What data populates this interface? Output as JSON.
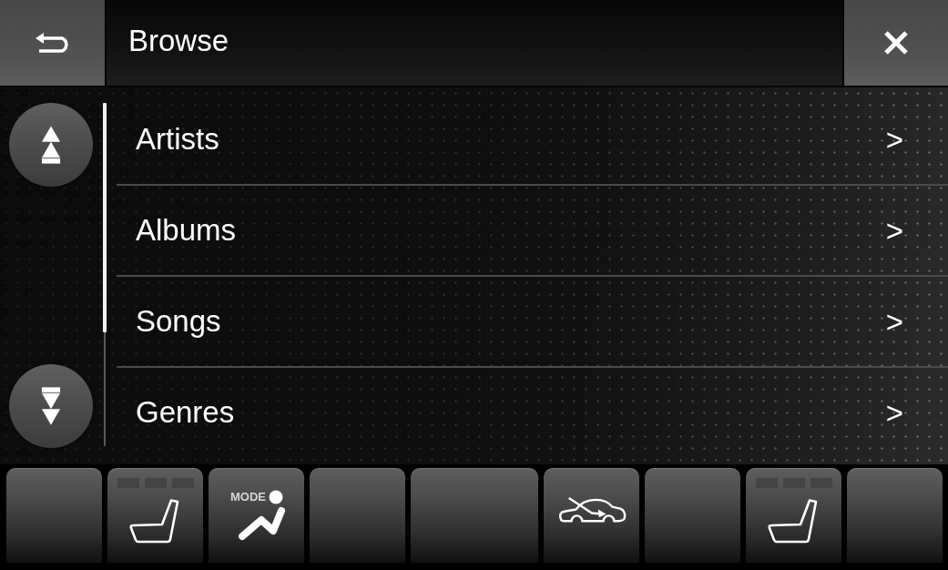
{
  "header": {
    "title": "Browse"
  },
  "list": {
    "items": [
      {
        "label": "Artists",
        "chevron": ">"
      },
      {
        "label": "Albums",
        "chevron": ">"
      },
      {
        "label": "Songs",
        "chevron": ">"
      },
      {
        "label": "Genres",
        "chevron": ">"
      }
    ]
  },
  "bottom_bar": {
    "buttons": [
      {
        "kind": "empty",
        "wide": false
      },
      {
        "kind": "seat_heater",
        "wide": false,
        "heat_segments": [
          {
            "on": false
          },
          {
            "on": false
          },
          {
            "on": false
          }
        ]
      },
      {
        "kind": "mode",
        "wide": false,
        "label": "MODE"
      },
      {
        "kind": "empty",
        "wide": false
      },
      {
        "kind": "empty",
        "wide": true
      },
      {
        "kind": "recirculation",
        "wide": false
      },
      {
        "kind": "empty",
        "wide": false
      },
      {
        "kind": "seat_heater",
        "wide": false,
        "heat_segments": [
          {
            "on": false
          },
          {
            "on": false
          },
          {
            "on": false
          }
        ]
      },
      {
        "kind": "empty",
        "wide": false
      }
    ]
  }
}
